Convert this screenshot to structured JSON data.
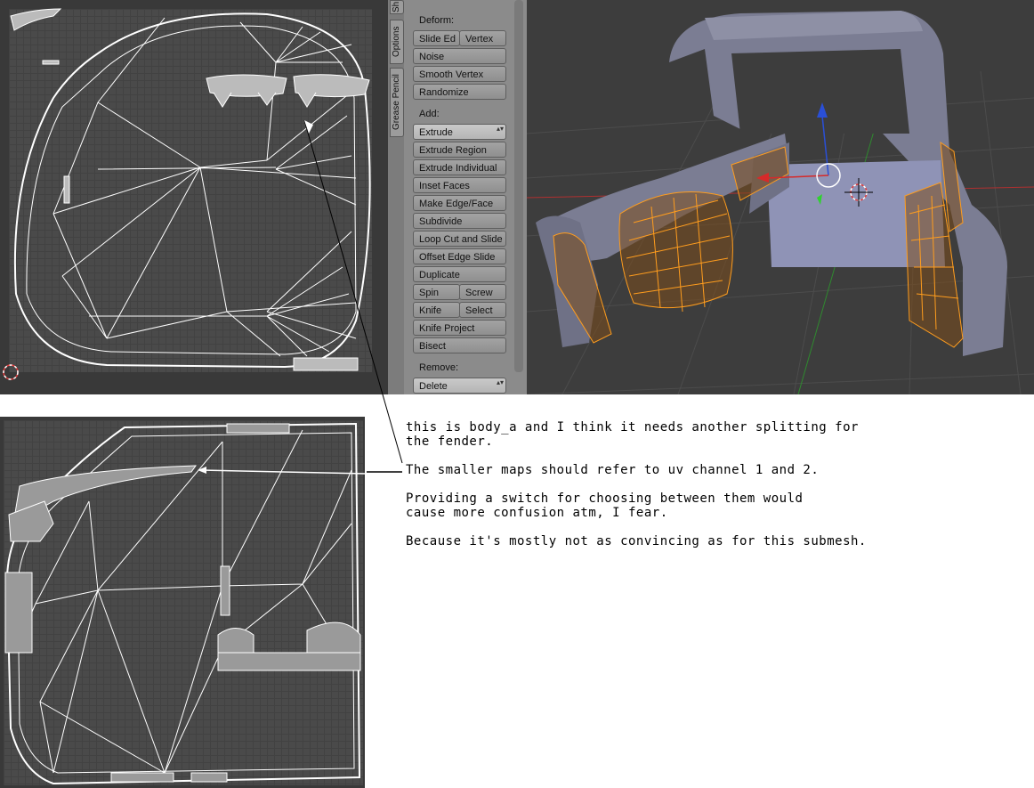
{
  "tool_shelf": {
    "tabs": [
      "Sh",
      "Options",
      "Grease Pencil"
    ],
    "sections": {
      "deform": "Deform:",
      "add": "Add:",
      "remove": "Remove:"
    },
    "deform_buttons": [
      "Slide Ed",
      "Vertex",
      "Noise",
      "Smooth Vertex",
      "Randomize"
    ],
    "add_buttons": [
      "Extrude",
      "Extrude Region",
      "Extrude Individual",
      "Inset Faces",
      "Make Edge/Face",
      "Subdivide",
      "Loop Cut and Slide",
      "Offset Edge Slide",
      "Duplicate",
      "Spin",
      "Screw",
      "Knife",
      "Select",
      "Knife Project",
      "Bisect"
    ],
    "remove_buttons": [
      "Delete"
    ]
  },
  "notes": {
    "line1": "this is body_a and I think it needs another splitting for\nthe fender.",
    "line2": "The smaller maps should refer to uv channel 1 and 2.",
    "line3": "Providing a switch for choosing between them would\ncause more confusion atm, I fear.",
    "line4": "Because it's mostly not as convincing as for this submesh."
  },
  "colors": {
    "selection": "#ff9d1e",
    "uv_wire": "#ffffff",
    "model": "#7b7d93",
    "bed": "#8f93b6"
  },
  "icons": {
    "cursor": "3d-cursor-icon",
    "gizmo": "transform-gizmo-icon",
    "uv_cursor": "uv-cursor-icon"
  }
}
